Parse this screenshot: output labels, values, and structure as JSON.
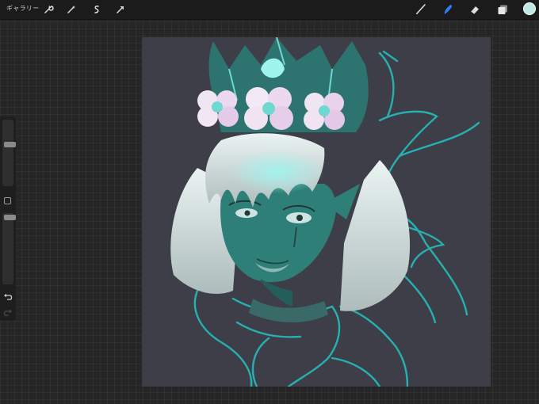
{
  "toolbar": {
    "gallery_label": "ギャラリー",
    "left_tools": [
      "wrench-icon",
      "magic-wand-icon",
      "selection-icon",
      "transform-icon"
    ],
    "right_tools": [
      "brush-icon",
      "smudge-icon",
      "eraser-icon",
      "layers-icon"
    ],
    "active_tool": "smudge-icon",
    "current_color": "#bfe8e4"
  },
  "sidebar": {
    "brush_size_level": 0.35,
    "opacity_level": 0.0
  },
  "colors": {
    "accent": "#2f7cf6",
    "canvas_background": "#3e3e48",
    "sketch_line": "#27b0b0"
  }
}
